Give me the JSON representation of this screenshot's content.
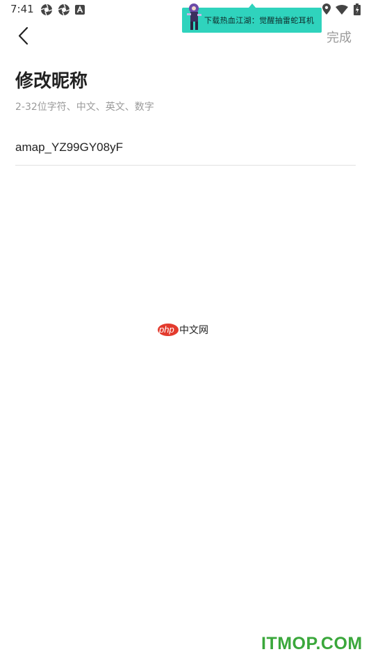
{
  "status_bar": {
    "time": "7:41",
    "left_icons": [
      "aperture-icon",
      "aperture-icon",
      "a-notification-icon"
    ],
    "right_icons": [
      "location-icon",
      "wifi-icon",
      "battery-icon"
    ]
  },
  "ad_banner": {
    "text": "下载热血江湖：觉醒抽雷蛇耳机",
    "color": "#2fd3bd"
  },
  "header": {
    "back_icon": "chevron-left-icon",
    "done_label": "完成"
  },
  "form": {
    "title": "修改昵称",
    "hint": "2-32位字符、中文、英文、数字",
    "nickname_value": "amap_YZ99GY08yF"
  },
  "watermarks": {
    "php_logo": "php",
    "php_site": "中文网",
    "itmop": "ITMOP.COM"
  }
}
